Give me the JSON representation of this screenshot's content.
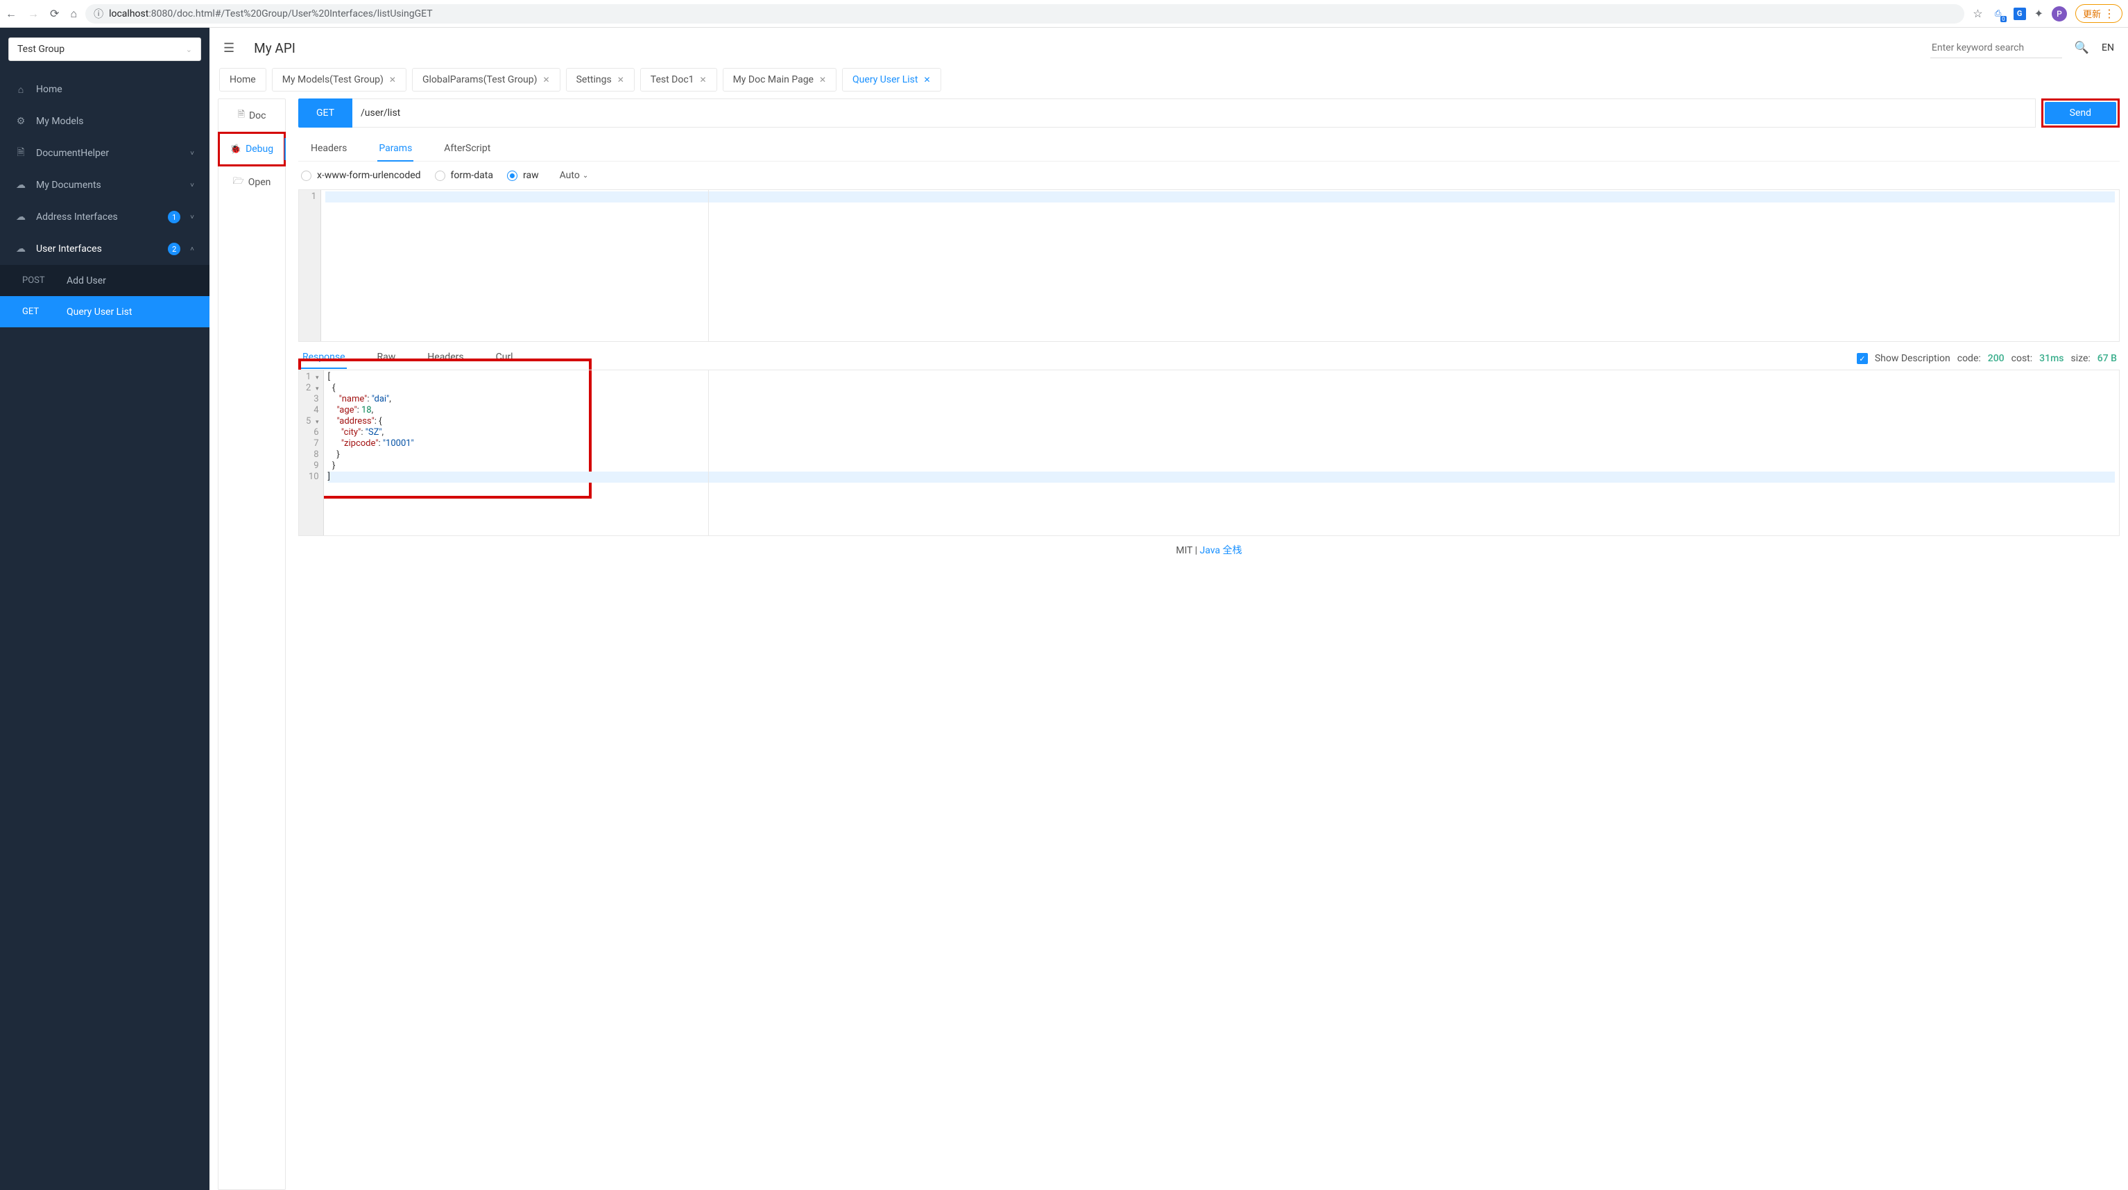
{
  "browser": {
    "url_host": "localhost",
    "url_port_path": ":8080/doc.html#/Test%20Group/User%20Interfaces/listUsingGET",
    "update_label": "更新",
    "avatar_letter": "P",
    "ext_badge": "0",
    "ext2_letter": "G"
  },
  "sidebar": {
    "group": "Test Group",
    "items": [
      {
        "icon": "⌂",
        "label": "Home"
      },
      {
        "icon": "⚙",
        "label": "My Models"
      },
      {
        "icon": "🗎",
        "label": "DocumentHelper",
        "expandable": true
      },
      {
        "icon": "☁",
        "label": "My Documents",
        "expandable": true
      },
      {
        "icon": "☁",
        "label": "Address Interfaces",
        "badge": "1",
        "expandable": true
      },
      {
        "icon": "☁",
        "label": "User Interfaces",
        "badge": "2",
        "expandable": true,
        "expanded": true
      }
    ],
    "user_sub": [
      {
        "method": "POST",
        "label": "Add User"
      },
      {
        "method": "GET",
        "label": "Query User List",
        "active": true
      }
    ]
  },
  "topbar": {
    "title": "My API",
    "search_placeholder": "Enter keyword search",
    "lang": "EN"
  },
  "tabs": [
    {
      "label": "Home",
      "closable": false
    },
    {
      "label": "My Models(Test Group)",
      "closable": true
    },
    {
      "label": "GlobalParams(Test Group)",
      "closable": true
    },
    {
      "label": "Settings",
      "closable": true
    },
    {
      "label": "Test Doc1",
      "closable": true
    },
    {
      "label": "My Doc Main Page",
      "closable": true
    },
    {
      "label": "Query User List",
      "closable": true,
      "active": true
    }
  ],
  "side_tabs": [
    {
      "icon": "🗎",
      "label": "Doc"
    },
    {
      "icon": "🐞",
      "label": "Debug",
      "active": true,
      "highlight": true
    },
    {
      "icon": "🗁",
      "label": "Open"
    }
  ],
  "request": {
    "method": "GET",
    "path": "/user/list",
    "send": "Send"
  },
  "inner_tabs": [
    {
      "label": "Headers"
    },
    {
      "label": "Params",
      "active": true
    },
    {
      "label": "AfterScript"
    }
  ],
  "body_types": [
    {
      "label": "x-www-form-urlencoded"
    },
    {
      "label": "form-data"
    },
    {
      "label": "raw",
      "checked": true
    }
  ],
  "auto_label": "Auto",
  "req_body_lines": [
    "1"
  ],
  "resp_tabs": [
    {
      "label": "Response",
      "active": true
    },
    {
      "label": "Raw"
    },
    {
      "label": "Headers"
    },
    {
      "label": "Curl"
    }
  ],
  "resp_meta": {
    "show_desc": "Show Description",
    "code_label": "code:",
    "code_val": "200",
    "cost_label": "cost:",
    "cost_val": "31ms",
    "size_label": "size:",
    "size_val": "67 B"
  },
  "resp_json": {
    "lines": [
      {
        "n": "1",
        "fold": true,
        "txt": "["
      },
      {
        "n": "2",
        "fold": true,
        "txt": "  {"
      },
      {
        "n": "3",
        "txt": "     \"name\": \"dai\","
      },
      {
        "n": "4",
        "txt": "    \"age\": 18,"
      },
      {
        "n": "5",
        "fold": true,
        "txt": "    \"address\": {"
      },
      {
        "n": "6",
        "txt": "      \"city\": \"SZ\","
      },
      {
        "n": "7",
        "txt": "      \"zipcode\": \"10001\""
      },
      {
        "n": "8",
        "txt": "    }"
      },
      {
        "n": "9",
        "txt": "  }"
      },
      {
        "n": "10",
        "txt": "]",
        "hl": true
      }
    ]
  },
  "footer": {
    "mit": "MIT | ",
    "link": "Java 全栈"
  }
}
